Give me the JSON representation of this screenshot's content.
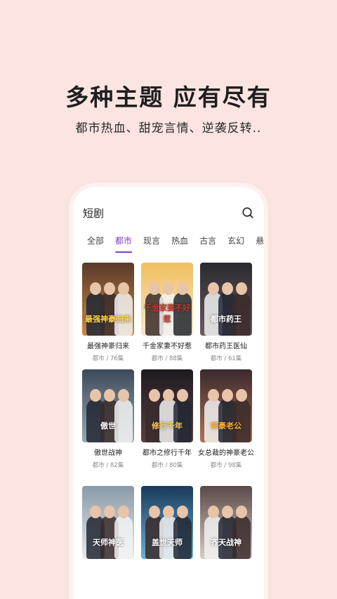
{
  "promo": {
    "headline": "多种主题 应有尽有",
    "subline": "都市热血、甜宠言情、逆袭反转.."
  },
  "app": {
    "title": "短剧",
    "search_icon": "search-icon"
  },
  "tabs": [
    {
      "label": "全部",
      "active": false
    },
    {
      "label": "都市",
      "active": true
    },
    {
      "label": "现言",
      "active": false
    },
    {
      "label": "热血",
      "active": false
    },
    {
      "label": "古言",
      "active": false
    },
    {
      "label": "玄幻",
      "active": false
    },
    {
      "label": "悬",
      "active": false
    }
  ],
  "dramas": [
    {
      "title": "最强神豪归来",
      "meta": "都市 / 76集",
      "poster_text": "最强神豪归来",
      "colors": [
        "#5a3a2a",
        "#c98a4a"
      ],
      "text_color": "#ffd34a"
    },
    {
      "title": "千金家妻不好惹",
      "meta": "都市 / 88集",
      "poster_text": "千金家妻不好惹",
      "colors": [
        "#f0c060",
        "#f7e6c8"
      ],
      "text_color": "#c0392b"
    },
    {
      "title": "都市药王医仙",
      "meta": "都市 / 61集",
      "poster_text": "都市药王",
      "colors": [
        "#2a2a30",
        "#6a5a60"
      ],
      "text_color": "#ffffff"
    },
    {
      "title": "傲世战神",
      "meta": "都市 / 82集",
      "poster_text": "傲世",
      "colors": [
        "#3c4a5a",
        "#9aa8b4"
      ],
      "text_color": "#ffffff"
    },
    {
      "title": "都市之修行千年",
      "meta": "都市 / 80集",
      "poster_text": "修行千年",
      "colors": [
        "#1e1a22",
        "#5a4040"
      ],
      "text_color": "#ffcf5a"
    },
    {
      "title": "女总裁的神豪老公",
      "meta": "都市 / 98集",
      "poster_text": "神豪老公",
      "colors": [
        "#3a2a30",
        "#b07050"
      ],
      "text_color": "#ffb030"
    },
    {
      "title": "",
      "meta": "",
      "poster_text": "天师神医",
      "colors": [
        "#8a9aa8",
        "#e8ecef"
      ],
      "text_color": "#ffffff"
    },
    {
      "title": "",
      "meta": "",
      "poster_text": "盖世天师",
      "colors": [
        "#1a3a5a",
        "#6ab0d8"
      ],
      "text_color": "#ffffff"
    },
    {
      "title": "",
      "meta": "",
      "poster_text": "齐天战神",
      "colors": [
        "#5a4a4a",
        "#d8ccc4"
      ],
      "text_color": "#ffffff"
    }
  ]
}
